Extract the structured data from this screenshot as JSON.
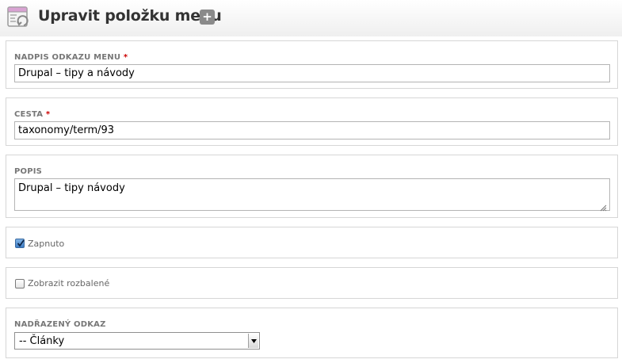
{
  "header": {
    "title": "Upravit položku menu",
    "add_shortcut_symbol": "+",
    "page_icon": "menu-edit-icon",
    "add_icon": "plus-icon"
  },
  "form": {
    "link_title": {
      "label": "NADPIS ODKAZU MENU",
      "required_mark": "*",
      "value": "Drupal – tipy a návody"
    },
    "path": {
      "label": "CESTA",
      "required_mark": "*",
      "value": "taxonomy/term/93"
    },
    "description": {
      "label": "POPIS",
      "value": "Drupal – tipy návody"
    },
    "enabled": {
      "label": "Zapnuto",
      "checked": true
    },
    "expanded": {
      "label": "Zobrazit rozbalené",
      "checked": false
    },
    "parent": {
      "label": "NADŘAZENÝ ODKAZ",
      "selected": "-- Články"
    }
  },
  "colors": {
    "required": "#cc0000",
    "label": "#777777",
    "border": "#d6d6d6",
    "checkbox_checked": "#3d7cc4"
  }
}
